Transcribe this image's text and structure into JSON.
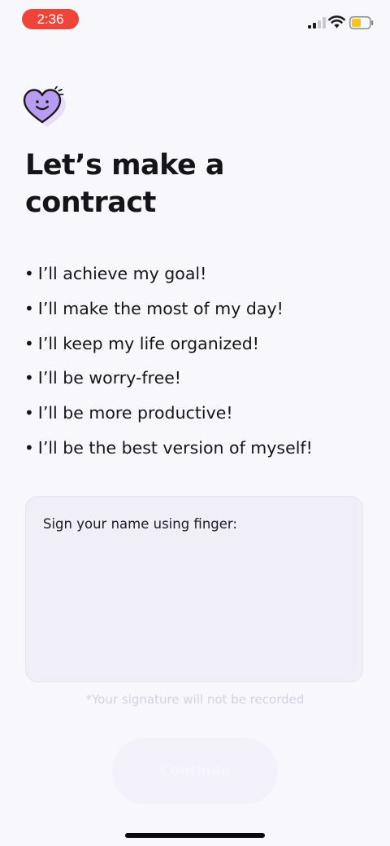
{
  "status_bar": {
    "time": "2:36",
    "icons": [
      "cellular-signal-icon",
      "wifi-icon",
      "battery-low-icon"
    ],
    "time_pill_color": "#f0433a",
    "battery_color": "#f5c518"
  },
  "header": {
    "icon": "smiling-heart-icon",
    "title": "Let’s make a contract"
  },
  "promises": [
    "I’ll achieve my goal!",
    "I’ll make the most of my day!",
    "I’ll keep my life organized!",
    "I’ll be worry-free!",
    "I’ll be more productive!",
    "I’ll be the best version of myself!"
  ],
  "signature": {
    "label": "Sign your name using finger:",
    "note": "*Your signature will not be recorded"
  },
  "continue_button": {
    "label": "Continue",
    "state": "disabled"
  },
  "colors": {
    "accent_heart": "#b79cf2",
    "background": "#f8f7fc"
  }
}
